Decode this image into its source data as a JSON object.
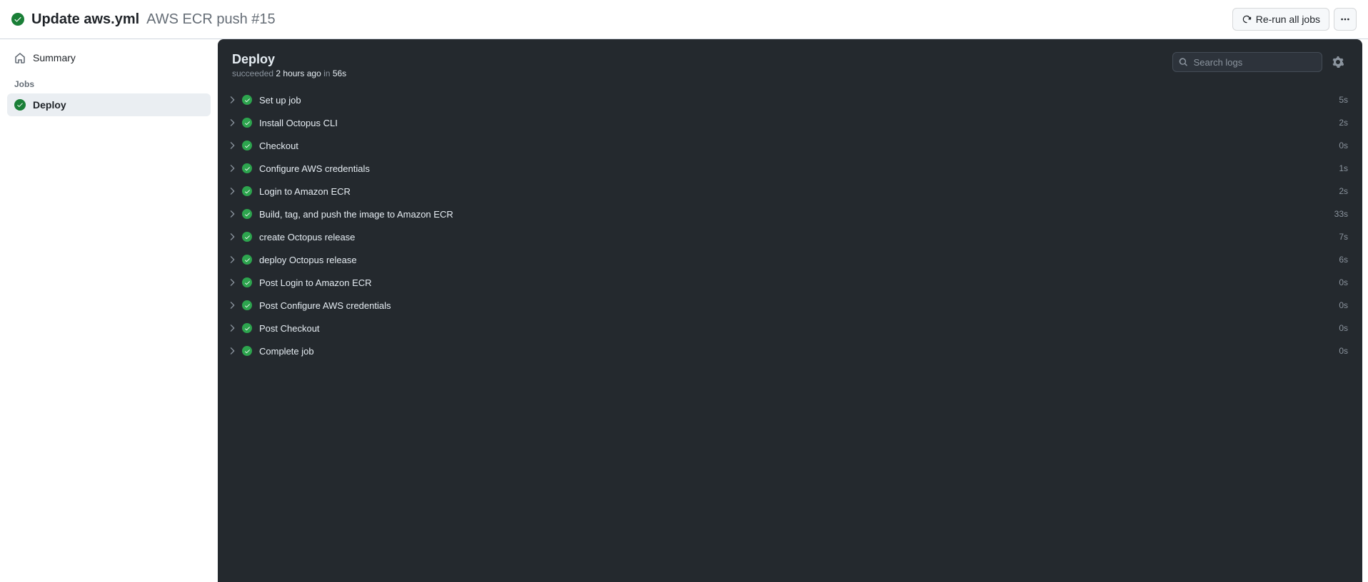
{
  "header": {
    "title_main": "Update aws.yml",
    "title_workflow": "AWS ECR push",
    "title_run": "#15",
    "rerun_label": "Re-run all jobs"
  },
  "sidebar": {
    "summary_label": "Summary",
    "jobs_heading": "Jobs",
    "jobs": [
      {
        "name": "Deploy"
      }
    ]
  },
  "panel": {
    "title": "Deploy",
    "status_prefix": "succeeded",
    "time_ago": "2 hours ago",
    "in_word": "in",
    "duration": "56s",
    "search_placeholder": "Search logs"
  },
  "steps": [
    {
      "name": "Set up job",
      "duration": "5s"
    },
    {
      "name": "Install Octopus CLI",
      "duration": "2s"
    },
    {
      "name": "Checkout",
      "duration": "0s"
    },
    {
      "name": "Configure AWS credentials",
      "duration": "1s"
    },
    {
      "name": "Login to Amazon ECR",
      "duration": "2s"
    },
    {
      "name": "Build, tag, and push the image to Amazon ECR",
      "duration": "33s"
    },
    {
      "name": "create Octopus release",
      "duration": "7s"
    },
    {
      "name": "deploy Octopus release",
      "duration": "6s"
    },
    {
      "name": "Post Login to Amazon ECR",
      "duration": "0s"
    },
    {
      "name": "Post Configure AWS credentials",
      "duration": "0s"
    },
    {
      "name": "Post Checkout",
      "duration": "0s"
    },
    {
      "name": "Complete job",
      "duration": "0s"
    }
  ]
}
